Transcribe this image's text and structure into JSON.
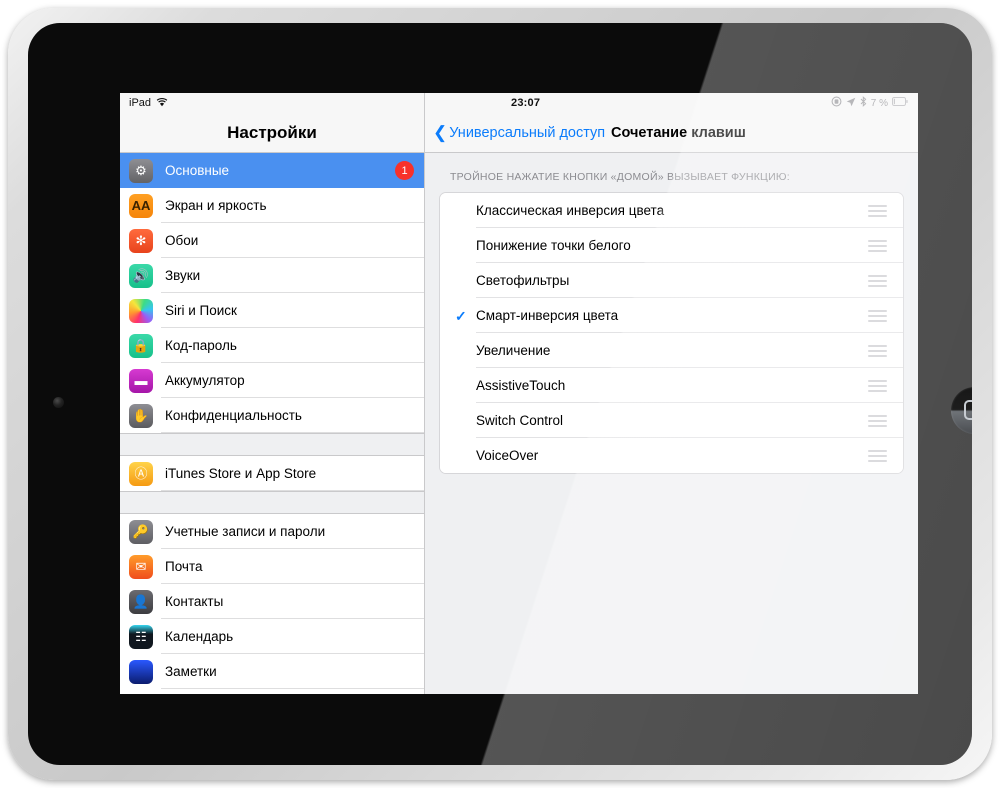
{
  "device": {
    "home_button_icon": "home-square-icon",
    "camera_icon": "front-camera-icon"
  },
  "sidebar": {
    "statusbar": {
      "carrier": "iPad",
      "wifi_icon": "wifi-icon"
    },
    "title": "Настройки",
    "groups": [
      {
        "items": [
          {
            "label": "Основные",
            "icon": "gear-icon",
            "icon_class": "ic-general",
            "glyph": "⚙",
            "selected": true,
            "badge": "1"
          },
          {
            "label": "Экран и яркость",
            "icon": "display-aa-icon",
            "icon_class": "ic-display",
            "glyph": "AA",
            "selected": false,
            "badge": ""
          },
          {
            "label": "Обои",
            "icon": "wallpaper-icon",
            "icon_class": "ic-wall",
            "glyph": "✻",
            "selected": false,
            "badge": ""
          },
          {
            "label": "Звуки",
            "icon": "speaker-icon",
            "icon_class": "ic-sounds",
            "glyph": "🔊",
            "selected": false,
            "badge": ""
          },
          {
            "label": "Siri и Поиск",
            "icon": "siri-icon",
            "icon_class": "ic-siri",
            "glyph": "",
            "selected": false,
            "badge": ""
          },
          {
            "label": "Код-пароль",
            "icon": "lock-icon",
            "icon_class": "ic-passcode",
            "glyph": "🔒",
            "selected": false,
            "badge": ""
          },
          {
            "label": "Аккумулятор",
            "icon": "battery-icon",
            "icon_class": "ic-battery",
            "glyph": "▬",
            "selected": false,
            "badge": ""
          },
          {
            "label": "Конфиденциальность",
            "icon": "hand-icon",
            "icon_class": "ic-privacy",
            "glyph": "✋",
            "selected": false,
            "badge": ""
          }
        ]
      },
      {
        "items": [
          {
            "label": "iTunes Store и App Store",
            "icon": "app-store-icon",
            "icon_class": "ic-itunes",
            "glyph": "Ⓐ",
            "selected": false,
            "badge": ""
          }
        ]
      },
      {
        "items": [
          {
            "label": "Учетные записи и пароли",
            "icon": "key-icon",
            "icon_class": "ic-accounts",
            "glyph": "🔑",
            "selected": false,
            "badge": ""
          },
          {
            "label": "Почта",
            "icon": "mail-icon",
            "icon_class": "ic-mail",
            "glyph": "✉",
            "selected": false,
            "badge": ""
          },
          {
            "label": "Контакты",
            "icon": "contacts-icon",
            "icon_class": "ic-contacts",
            "glyph": "👤",
            "selected": false,
            "badge": ""
          },
          {
            "label": "Календарь",
            "icon": "calendar-icon",
            "icon_class": "ic-calendar",
            "glyph": "☷",
            "selected": false,
            "badge": ""
          },
          {
            "label": "Заметки",
            "icon": "notes-icon",
            "icon_class": "ic-notes",
            "glyph": "",
            "selected": false,
            "badge": ""
          }
        ]
      }
    ]
  },
  "detail": {
    "statusbar": {
      "clock": "23:07",
      "icons": [
        "screen-rotation-lock-icon",
        "location-arrow-icon",
        "bluetooth-icon"
      ],
      "battery_percent": "7 %",
      "battery_icon": "battery-icon"
    },
    "navbar": {
      "back_icon": "chevron-left-icon",
      "back_label": "Универсальный доступ",
      "title": "Сочетание клавиш"
    },
    "section_header": "ТРОЙНОЕ НАЖАТИЕ КНОПКИ «ДОМОЙ» ВЫЗЫВАЕТ ФУНКЦИЮ:",
    "options": [
      {
        "label": "Классическая инверсия цвета",
        "checked": false,
        "check_glyph": "",
        "handle_icon": "reorder-handle-icon"
      },
      {
        "label": "Понижение точки белого",
        "checked": false,
        "check_glyph": "",
        "handle_icon": "reorder-handle-icon"
      },
      {
        "label": "Светофильтры",
        "checked": false,
        "check_glyph": "",
        "handle_icon": "reorder-handle-icon"
      },
      {
        "label": "Смарт-инверсия цвета",
        "checked": true,
        "check_glyph": "✓",
        "handle_icon": "reorder-handle-icon"
      },
      {
        "label": "Увеличение",
        "checked": false,
        "check_glyph": "",
        "handle_icon": "reorder-handle-icon"
      },
      {
        "label": "AssistiveTouch",
        "checked": false,
        "check_glyph": "",
        "handle_icon": "reorder-handle-icon"
      },
      {
        "label": "Switch Control",
        "checked": false,
        "check_glyph": "",
        "handle_icon": "reorder-handle-icon"
      },
      {
        "label": "VoiceOver",
        "checked": false,
        "check_glyph": "",
        "handle_icon": "reorder-handle-icon"
      }
    ]
  },
  "colors": {
    "accent_blue": "#0b7cfb",
    "selection_blue": "#4a90f0",
    "badge_red": "#f8312a",
    "panel_gray": "#eff0f2",
    "handle_gray": "#cdcdd1"
  }
}
